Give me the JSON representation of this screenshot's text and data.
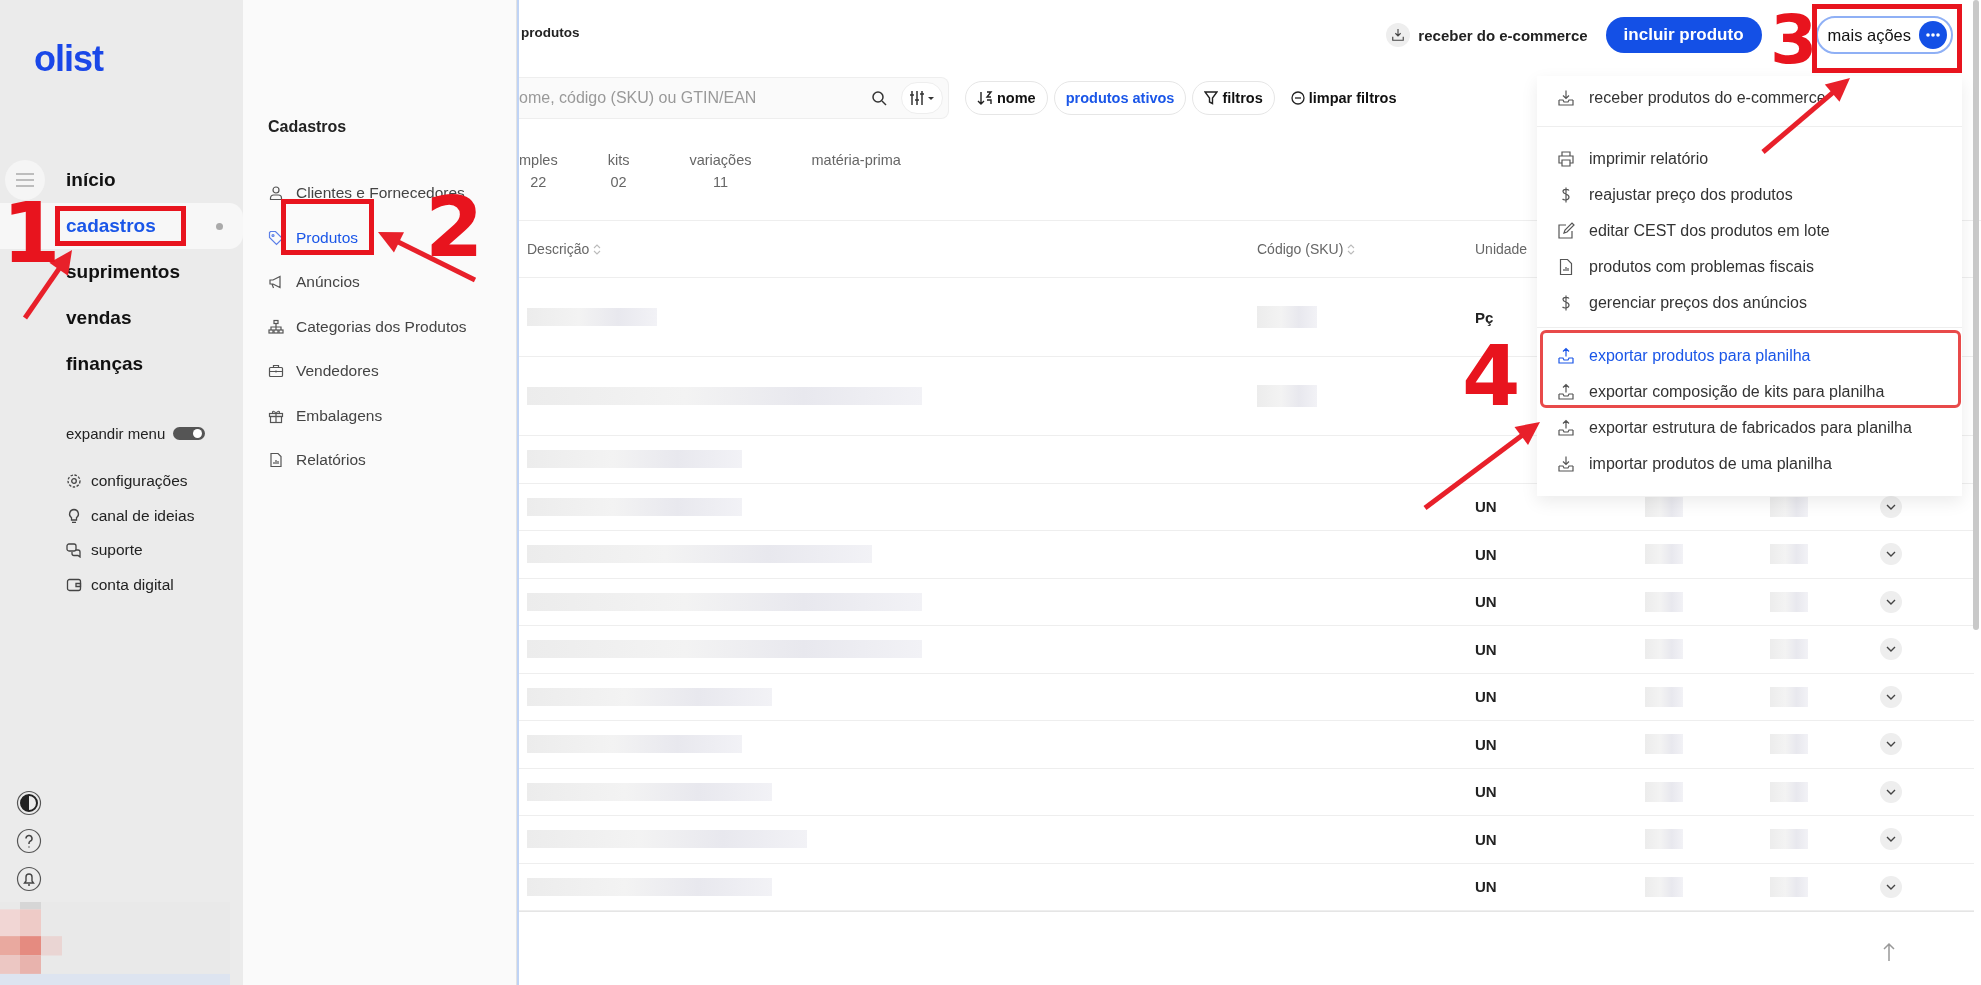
{
  "sidebar": {
    "logo": "olist",
    "nav": [
      {
        "label": "início",
        "selected": false
      },
      {
        "label": "cadastros",
        "selected": true
      },
      {
        "label": "suprimentos",
        "selected": false
      },
      {
        "label": "vendas",
        "selected": false
      },
      {
        "label": "finanças",
        "selected": false
      }
    ],
    "expand_menu": {
      "label": "expandir menu",
      "on": true
    },
    "links": [
      {
        "label": "configurações"
      },
      {
        "label": "canal de ideias"
      },
      {
        "label": "suporte"
      },
      {
        "label": "conta digital"
      }
    ]
  },
  "submenu": {
    "title": "Cadastros",
    "items": [
      {
        "label": "Clientes e Fornecedores",
        "selected": false
      },
      {
        "label": "Produtos",
        "selected": true
      },
      {
        "label": "Anúncios",
        "selected": false
      },
      {
        "label": "Categorias dos Produtos",
        "selected": false
      },
      {
        "label": "Vendedores",
        "selected": false
      },
      {
        "label": "Embalagens",
        "selected": false
      },
      {
        "label": "Relatórios",
        "selected": false
      }
    ]
  },
  "page": {
    "title": "produtos"
  },
  "header_actions": [
    {
      "label": "receber do e-commerce",
      "kind": "ghost"
    },
    {
      "label": "incluir produto",
      "kind": "primary"
    },
    {
      "label": "mais ações",
      "kind": "outline"
    }
  ],
  "search": {
    "placeholder": "ome, código (SKU) ou GTIN/EAN"
  },
  "chips": [
    {
      "label": "nome",
      "kind": "sort",
      "selected": false
    },
    {
      "label": "produtos ativos",
      "kind": "plain",
      "selected": true
    },
    {
      "label": "filtros",
      "kind": "filter",
      "selected": false
    },
    {
      "label": "limpar filtros",
      "kind": "clear",
      "selected": false
    }
  ],
  "tabs": [
    {
      "label": "mples",
      "count": "22"
    },
    {
      "label": "kits",
      "count": "02"
    },
    {
      "label": "variações",
      "count": "11"
    },
    {
      "label": "matéria-prima"
    }
  ],
  "table": {
    "columns": [
      "Descrição",
      "Código (SKU)",
      "Unidade"
    ],
    "rows": [
      {
        "unit": "Pç"
      },
      {},
      {},
      {
        "unit": "UN"
      },
      {
        "unit": "UN"
      },
      {
        "unit": "UN"
      },
      {
        "unit": "UN"
      },
      {
        "unit": "UN"
      },
      {
        "unit": "UN"
      },
      {
        "unit": "UN"
      },
      {
        "unit": "UN"
      },
      {
        "unit": "UN"
      }
    ]
  },
  "menu": {
    "groups": [
      [
        {
          "label": "receber produtos do e-commerce",
          "selected": false
        }
      ],
      [
        {
          "label": "imprimir relatório",
          "selected": false
        },
        {
          "label": "reajustar preço dos produtos",
          "selected": false
        },
        {
          "label": "editar CEST dos produtos em lote",
          "selected": false
        },
        {
          "label": "produtos com problemas fiscais",
          "selected": false
        },
        {
          "label": "gerenciar preços dos anúncios",
          "selected": false
        }
      ],
      [
        {
          "label": "exportar produtos para planilha",
          "selected": true
        },
        {
          "label": "exportar composição de kits para planilha",
          "selected": false
        },
        {
          "label": "exportar estrutura de fabricados para planilha",
          "selected": false
        },
        {
          "label": "importar produtos de uma planilha",
          "selected": false
        }
      ]
    ]
  },
  "annotations": [
    {
      "label": "1"
    },
    {
      "label": "2"
    },
    {
      "label": "3"
    },
    {
      "label": "4"
    }
  ]
}
